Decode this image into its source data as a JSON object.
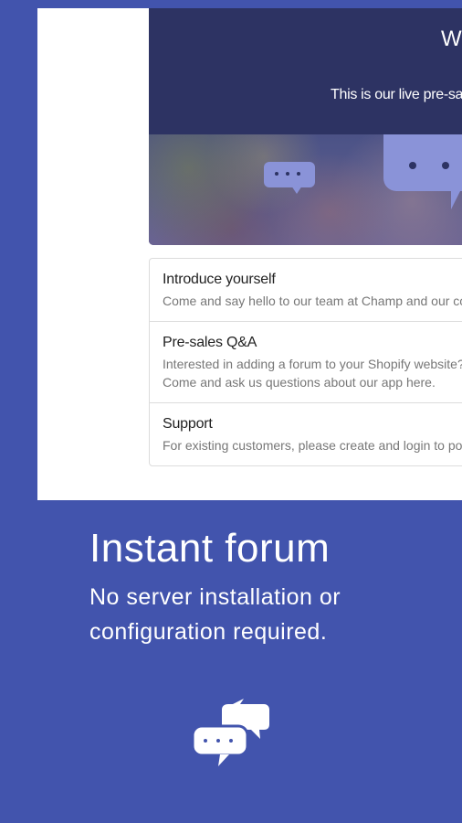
{
  "hero": {
    "title": "We",
    "subtitle": "This is our live pre-sale"
  },
  "forums": [
    {
      "name": "Introduce yourself",
      "description_lines": [
        "Come and say hello to our team at Champ and our co"
      ]
    },
    {
      "name": "Pre-sales Q&A",
      "description_lines": [
        "Interested in adding a forum to your Shopify website?",
        "Come and ask us questions about our app here."
      ]
    },
    {
      "name": "Support",
      "description_lines": [
        "For existing customers, please create and login to po"
      ]
    }
  ],
  "tagline": {
    "title": "Instant forum",
    "subtitle": "No server installation or configuration required."
  },
  "icons": {
    "small_bubble": "chat-bubble-icon",
    "large_bubble": "chat-bubble-icon",
    "logo": "chat-bubbles-logo-icon"
  },
  "colors": {
    "background": "#4254ad",
    "hero_dark": "#2d3363",
    "bubble": "#8a93d8"
  }
}
